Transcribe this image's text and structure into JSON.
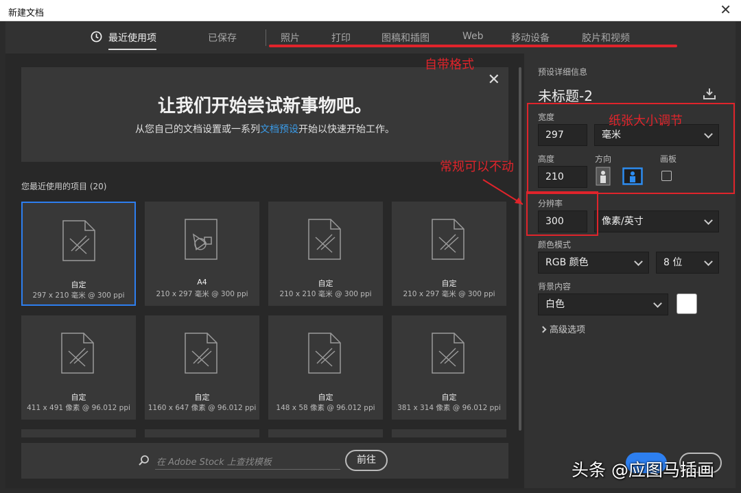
{
  "window": {
    "title": "新建文档",
    "close_glyph": "✕"
  },
  "tabs": [
    {
      "label": "最近使用项",
      "icon": "clock-icon",
      "active": true
    },
    {
      "label": "已保存"
    },
    {
      "label": "照片"
    },
    {
      "label": "打印"
    },
    {
      "label": "图稿和插图"
    },
    {
      "label": "Web"
    },
    {
      "label": "移动设备"
    },
    {
      "label": "胶片和视频"
    }
  ],
  "welcome": {
    "heading": "让我们开始尝试新事物吧。",
    "sub_before": "从您自己的文档设置或一系列",
    "sub_link": "文档预设",
    "sub_after": "开始以快速开始工作。",
    "close_glyph": "✕"
  },
  "recent": {
    "title": "您最近使用的项目",
    "count": "(20)"
  },
  "cards": [
    {
      "name": "自定",
      "desc": "297 x 210 毫米 @ 300 ppi",
      "icon": "document-ruler-icon"
    },
    {
      "name": "A4",
      "desc": "210 x 297 毫米 @ 300 ppi",
      "icon": "document-shapes-icon"
    },
    {
      "name": "自定",
      "desc": "210 x 210 毫米 @ 300 ppi",
      "icon": "document-ruler-icon"
    },
    {
      "name": "自定",
      "desc": "210 x 297 毫米 @ 300 ppi",
      "icon": "document-ruler-icon"
    },
    {
      "name": "自定",
      "desc": "411 x 491 像素 @ 96.012 ppi",
      "icon": "document-ruler-icon"
    },
    {
      "name": "自定",
      "desc": "1160 x 647 像素 @ 96.012 ppi",
      "icon": "document-ruler-icon"
    },
    {
      "name": "自定",
      "desc": "148 x 58 像素 @ 96.012 ppi",
      "icon": "document-ruler-icon"
    },
    {
      "name": "自定",
      "desc": "381 x 314 像素 @ 96.012 ppi",
      "icon": "document-ruler-icon"
    }
  ],
  "search": {
    "placeholder": "在 Adobe Stock 上查找模板",
    "go_label": "前往",
    "icon": "search-icon"
  },
  "preset": {
    "section_title": "预设详细信息",
    "doc_name": "未标题-2",
    "save_icon": "save-preset-icon",
    "width_label": "宽度",
    "width_value": "297",
    "unit_value": "毫米",
    "height_label": "高度",
    "height_value": "210",
    "orientation_label": "方向",
    "artboard_label": "画板",
    "resolution_label": "分辨率",
    "resolution_value": "300",
    "resolution_unit": "像素/英寸",
    "color_mode_label": "颜色模式",
    "color_mode_value": "RGB 颜色",
    "bit_depth_value": "8 位",
    "background_label": "背景内容",
    "background_value": "白色",
    "background_swatch": "#ffffff",
    "advanced_label": "高级选项"
  },
  "annotations": {
    "format": "自带格式",
    "paper_size": "纸张大小调节",
    "default_note": "常规可以不动"
  },
  "watermark": "头条 @应图马插画",
  "colors": {
    "accent": "#2d7ff0",
    "annotation_red": "#e0242b"
  }
}
